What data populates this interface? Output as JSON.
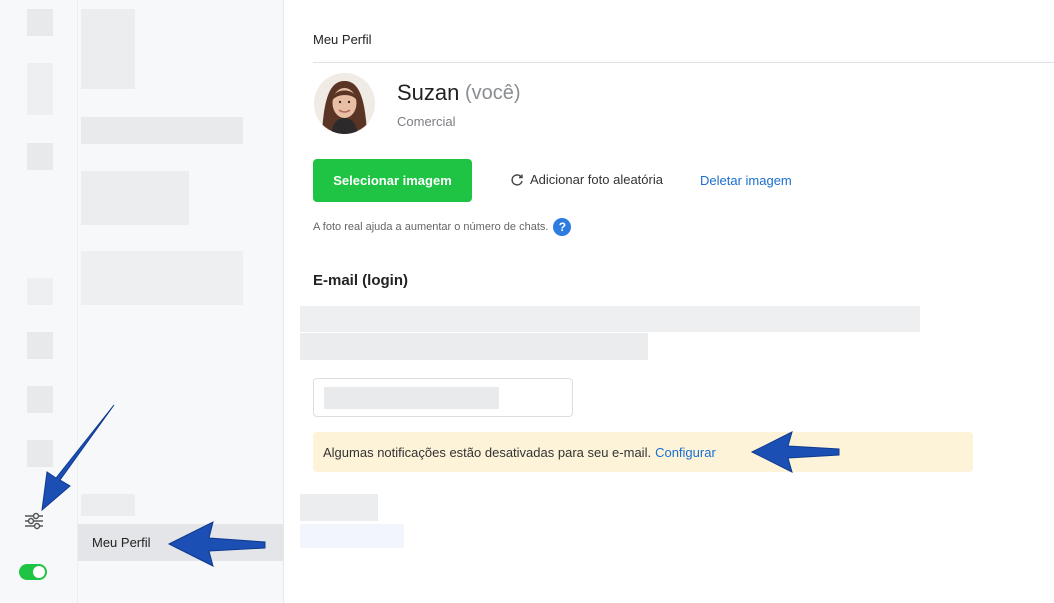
{
  "sidebar": {
    "active_item": "Meu Perfil"
  },
  "header": {
    "title": "Meu Perfil"
  },
  "profile": {
    "name": "Suzan",
    "you_tag": "(você)",
    "department": "Comercial",
    "select_image_label": "Selecionar imagem",
    "random_photo_label": "Adicionar foto aleatória",
    "delete_image_label": "Deletar imagem",
    "hint": "A foto real ajuda a aumentar o número de chats.",
    "help_symbol": "?"
  },
  "email_section": {
    "title": "E-mail (login)"
  },
  "notice": {
    "text": "Algumas notificações estão desativadas para seu e-mail.",
    "link": "Configurar"
  },
  "colors": {
    "accent_green": "#1fc445",
    "link_blue": "#1a6fcf",
    "notice_bg": "#fcf3d9",
    "annotation_arrow": "#1b4fb4"
  },
  "icons": {
    "settings": "sliders-icon",
    "refresh": "refresh-icon",
    "help": "question-icon",
    "toggle": "toggle-on"
  }
}
